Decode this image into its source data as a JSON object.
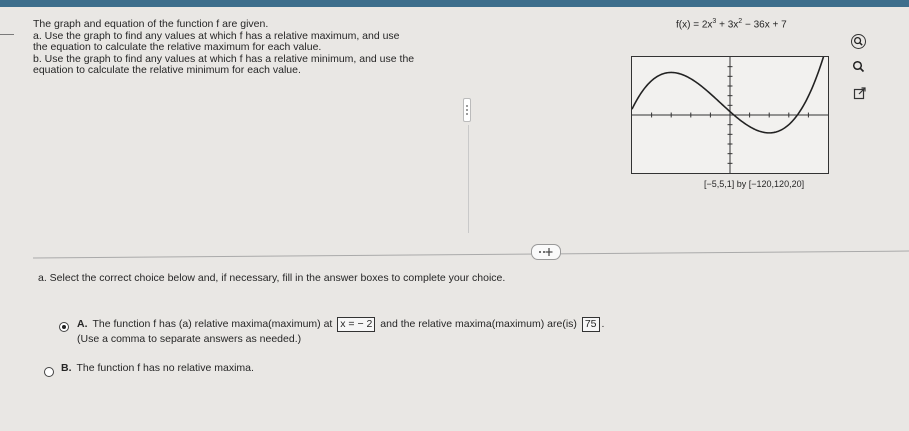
{
  "question": {
    "lines": [
      "The graph and equation of the function f are given.",
      "a. Use the graph to find any values at which f has a relative maximum, and use",
      "the equation to calculate the relative maximum for each value.",
      "b. Use the graph to find any values at which f has a relative minimum, and use the",
      "equation to calculate the relative minimum for each value."
    ],
    "equation_prefix": "f(x) = 2x",
    "equation_exp1": "3",
    "equation_mid": " + 3x",
    "equation_exp2": "2",
    "equation_suffix": " − 36x + 7"
  },
  "graph": {
    "window_label": "[−5,5,1] by [−120,120,20]",
    "xlim": [
      -5,
      5
    ],
    "ylim": [
      -120,
      120
    ],
    "function": "2x^3+3x^2-36x+7"
  },
  "tools": [
    "zoom-in-icon",
    "zoom-out-icon",
    "external-link-icon"
  ],
  "part_a": {
    "instruction": "a. Select the correct choice below and, if necessary, fill in the answer boxes to complete your choice.",
    "choice_a_letter": "A.",
    "choice_a_text1": "The function f has (a) relative maxima(maximum) at",
    "choice_a_box1": "x = − 2",
    "choice_a_text2": "and the relative maxima(maximum) are(is)",
    "choice_a_box2": "75",
    "choice_a_period": ".",
    "choice_a_hint": "(Use a comma to separate answers as needed.)",
    "choice_b_letter": "B.",
    "choice_b_text": "The function f has no relative maxima.",
    "selected": "A"
  }
}
